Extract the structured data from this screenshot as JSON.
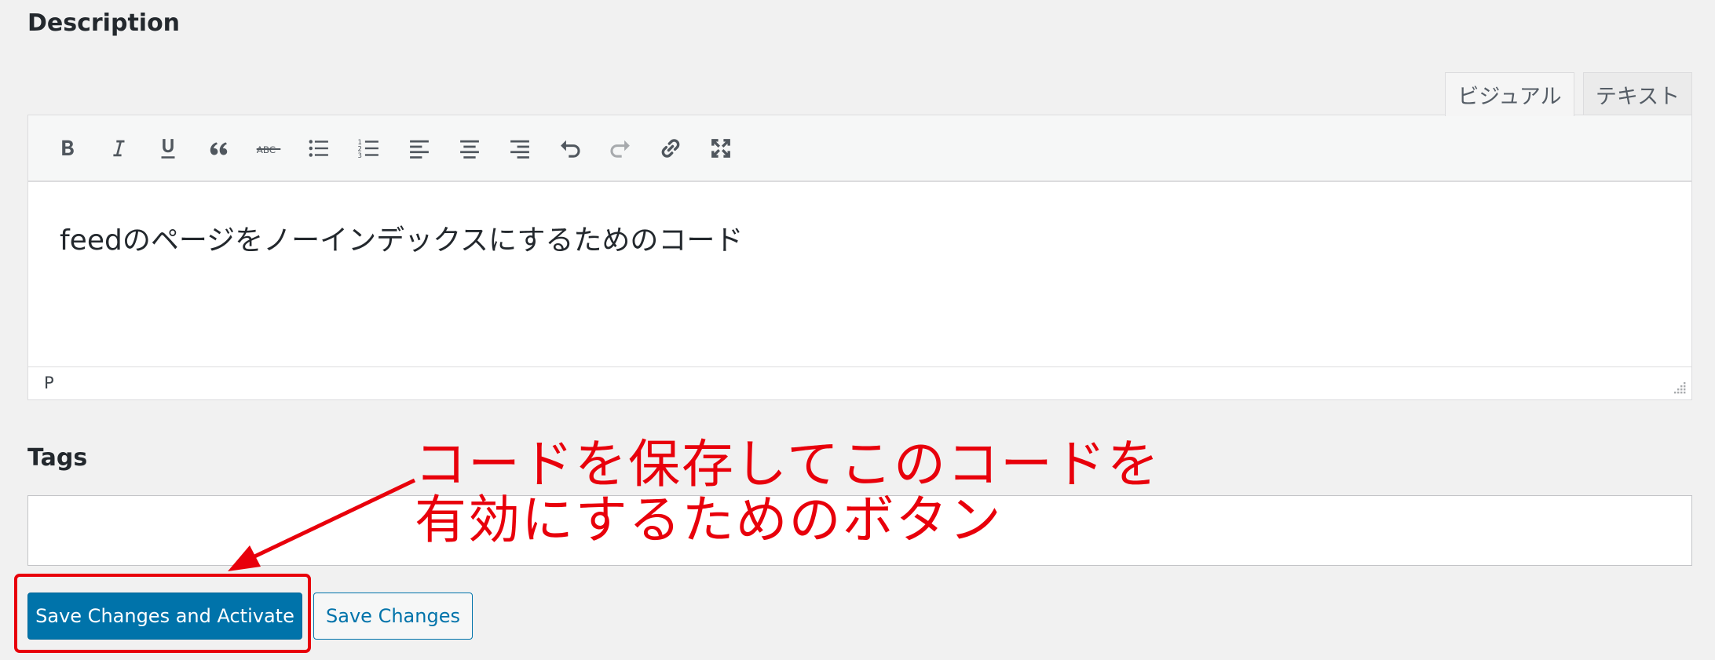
{
  "description": {
    "heading": "Description"
  },
  "editor": {
    "tabs": [
      {
        "label": "ビジュアル",
        "active": true
      },
      {
        "label": "テキスト",
        "active": false
      }
    ],
    "toolbar": [
      {
        "name": "bold"
      },
      {
        "name": "italic"
      },
      {
        "name": "underline"
      },
      {
        "name": "blockquote"
      },
      {
        "name": "strikethrough"
      },
      {
        "name": "bullet-list"
      },
      {
        "name": "numbered-list"
      },
      {
        "name": "align-left"
      },
      {
        "name": "align-center"
      },
      {
        "name": "align-right"
      },
      {
        "name": "undo"
      },
      {
        "name": "redo"
      },
      {
        "name": "link"
      },
      {
        "name": "fullscreen"
      }
    ],
    "content": "feedのページをノーインデックスにするためのコード",
    "path": "P"
  },
  "tags": {
    "heading": "Tags",
    "value": ""
  },
  "buttons": {
    "primary": "Save Changes and Activate",
    "secondary": "Save Changes"
  },
  "annotation": {
    "line1": "コードを保存してこのコードを",
    "line2": "有効にするためのボタン",
    "color": "#e8000b"
  }
}
